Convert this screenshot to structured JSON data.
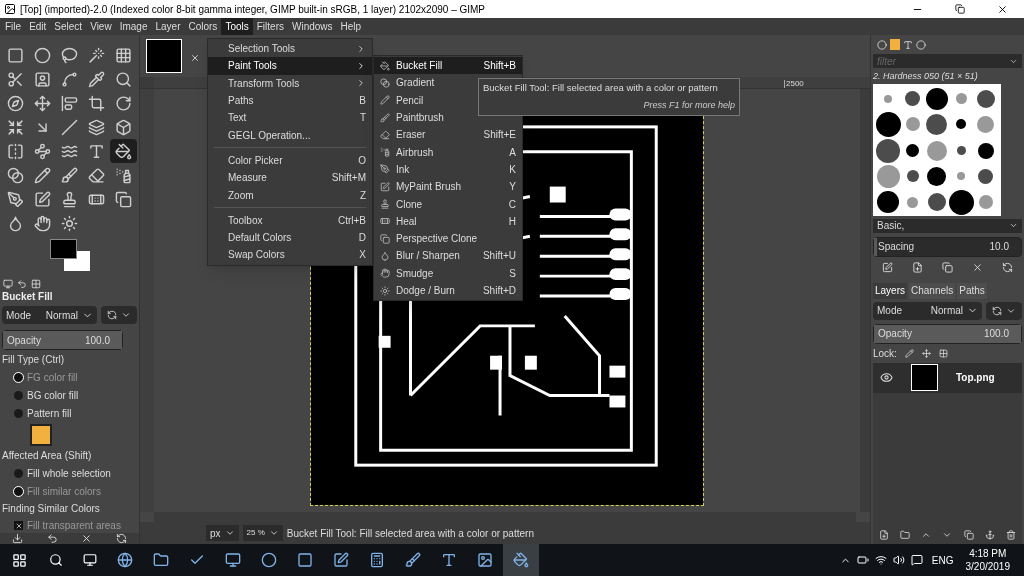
{
  "window": {
    "title": "[Top] (imported)-2.0 (Indexed color 8-bit gamma integer, GIMP built-in sRGB, 1 layer) 2102x2090 – GIMP"
  },
  "menubar": [
    {
      "label": "File",
      "selected": false
    },
    {
      "label": "Edit",
      "selected": false
    },
    {
      "label": "Select",
      "selected": false
    },
    {
      "label": "View",
      "selected": false
    },
    {
      "label": "Image",
      "selected": false
    },
    {
      "label": "Layer",
      "selected": false
    },
    {
      "label": "Colors",
      "selected": false
    },
    {
      "label": "Tools",
      "selected": true
    },
    {
      "label": "Filters",
      "selected": false
    },
    {
      "label": "Windows",
      "selected": false
    },
    {
      "label": "Help",
      "selected": false
    }
  ],
  "toolbox": {
    "tools": [
      {
        "selected": false
      },
      {
        "selected": false
      },
      {
        "selected": false
      },
      {
        "selected": false
      },
      {
        "selected": false
      },
      {
        "selected": false
      },
      {
        "selected": false
      },
      {
        "selected": false
      },
      {
        "selected": false
      },
      {
        "selected": false
      },
      {
        "selected": false
      },
      {
        "selected": false
      },
      {
        "selected": false
      },
      {
        "selected": false
      },
      {
        "selected": false
      },
      {
        "selected": false
      },
      {
        "selected": false
      },
      {
        "selected": false
      },
      {
        "selected": false
      },
      {
        "selected": false
      },
      {
        "selected": false
      },
      {
        "selected": false
      },
      {
        "selected": false
      },
      {
        "selected": false
      },
      {
        "selected": true
      },
      {
        "selected": false
      },
      {
        "selected": false
      },
      {
        "selected": false
      },
      {
        "selected": false
      },
      {
        "selected": false
      },
      {
        "selected": false
      },
      {
        "selected": false
      },
      {
        "selected": false
      },
      {
        "selected": false
      },
      {
        "selected": false
      },
      {
        "selected": false
      },
      {
        "selected": false
      },
      {
        "selected": false
      }
    ]
  },
  "tool_options": {
    "title": "Bucket Fill",
    "mode": {
      "label": "Mode",
      "value": "Normal"
    },
    "opacity": {
      "label": "Opacity",
      "value": "100.0",
      "level": 1
    },
    "fill_type": {
      "label": "Fill Type  (Ctrl)",
      "options": [
        {
          "label": "FG color fill",
          "selected": true
        },
        {
          "label": "BG color fill",
          "selected": false
        },
        {
          "label": "Pattern fill",
          "selected": false
        }
      ]
    },
    "affected_area": {
      "label": "Affected Area  (Shift)",
      "options": [
        {
          "label": "Fill whole selection",
          "selected": false
        },
        {
          "label": "Fill similar colors",
          "selected": true
        }
      ]
    },
    "similar_colors": {
      "label": "Finding Similar Colors",
      "options": [
        {
          "label": "Fill transparent areas",
          "checked": true
        }
      ]
    }
  },
  "tools_menu": [
    {
      "kind": "submenu",
      "label": "Selection Tools",
      "selected": false
    },
    {
      "kind": "submenu",
      "label": "Paint Tools",
      "selected": true
    },
    {
      "kind": "submenu",
      "label": "Transform Tools",
      "selected": false
    },
    {
      "kind": "item",
      "label": "Paths",
      "shortcut": "B",
      "selected": false
    },
    {
      "kind": "item",
      "label": "Text",
      "shortcut": "T",
      "selected": false
    },
    {
      "kind": "item",
      "label": "GEGL Operation...",
      "selected": false
    },
    {
      "kind": "separator"
    },
    {
      "kind": "item",
      "label": "Color Picker",
      "shortcut": "O",
      "selected": false
    },
    {
      "kind": "item",
      "label": "Measure",
      "shortcut": "Shift+M",
      "selected": false
    },
    {
      "kind": "item",
      "label": "Zoom",
      "shortcut": "Z",
      "selected": false
    },
    {
      "kind": "separator"
    },
    {
      "kind": "item",
      "label": "Toolbox",
      "shortcut": "Ctrl+B",
      "selected": false
    },
    {
      "kind": "item",
      "label": "Default Colors",
      "shortcut": "D",
      "selected": false
    },
    {
      "kind": "item",
      "label": "Swap Colors",
      "shortcut": "X",
      "selected": false
    }
  ],
  "paint_tools_menu": [
    {
      "label": "Bucket Fill",
      "shortcut": "Shift+B",
      "selected": true
    },
    {
      "label": "Gradient",
      "selected": false
    },
    {
      "label": "Pencil",
      "selected": false
    },
    {
      "label": "Paintbrush",
      "selected": false
    },
    {
      "label": "Eraser",
      "shortcut": "Shift+E",
      "selected": false
    },
    {
      "label": "Airbrush",
      "shortcut": "A",
      "selected": false
    },
    {
      "label": "Ink",
      "shortcut": "K",
      "selected": false
    },
    {
      "label": "MyPaint Brush",
      "shortcut": "Y",
      "selected": false
    },
    {
      "label": "Clone",
      "shortcut": "C",
      "selected": false
    },
    {
      "label": "Heal",
      "shortcut": "H",
      "selected": false
    },
    {
      "label": "Perspective Clone",
      "selected": false
    },
    {
      "label": "Blur / Sharpen",
      "shortcut": "Shift+U",
      "selected": false
    },
    {
      "label": "Smudge",
      "shortcut": "S",
      "selected": false
    },
    {
      "label": "Dodge / Burn",
      "shortcut": "Shift+D",
      "selected": false
    }
  ],
  "tooltip": {
    "text": "Bucket Fill Tool: Fill selected area with a color or pattern",
    "hint": "Press F1 for more help"
  },
  "canvas": {
    "ruler_label": "2500"
  },
  "status_bar": {
    "unit": "px",
    "zoom": "25 %",
    "message": "Bucket Fill Tool: Fill selected area with a color or pattern"
  },
  "brushes": {
    "filter_placeholder": "filter",
    "brush_name": "2. Hardness 050 (51 × 51)",
    "tag": "Basic,",
    "spacing": {
      "label": "Spacing",
      "value": "10.0",
      "level": 0.02
    }
  },
  "layers": {
    "tabs": [
      {
        "label": "Layers",
        "selected": true
      },
      {
        "label": "Channels",
        "selected": false
      },
      {
        "label": "Paths",
        "selected": false
      }
    ],
    "mode": {
      "label": "Mode",
      "value": "Normal"
    },
    "opacity": {
      "label": "Opacity",
      "value": "100.0",
      "level": 1
    },
    "lock_label": "Lock:",
    "items": [
      {
        "name": "Top.png",
        "visible": true
      }
    ]
  },
  "taskbar": {
    "language": "ENG",
    "time": "4:18 PM",
    "date": "3/20/2019",
    "apps": [
      {
        "selected": false
      },
      {
        "selected": false
      },
      {
        "selected": false
      },
      {
        "selected": false
      },
      {
        "selected": false
      },
      {
        "selected": false
      },
      {
        "selected": false
      },
      {
        "selected": false
      },
      {
        "selected": false
      },
      {
        "selected": false
      },
      {
        "selected": false
      },
      {
        "selected": true
      }
    ]
  }
}
